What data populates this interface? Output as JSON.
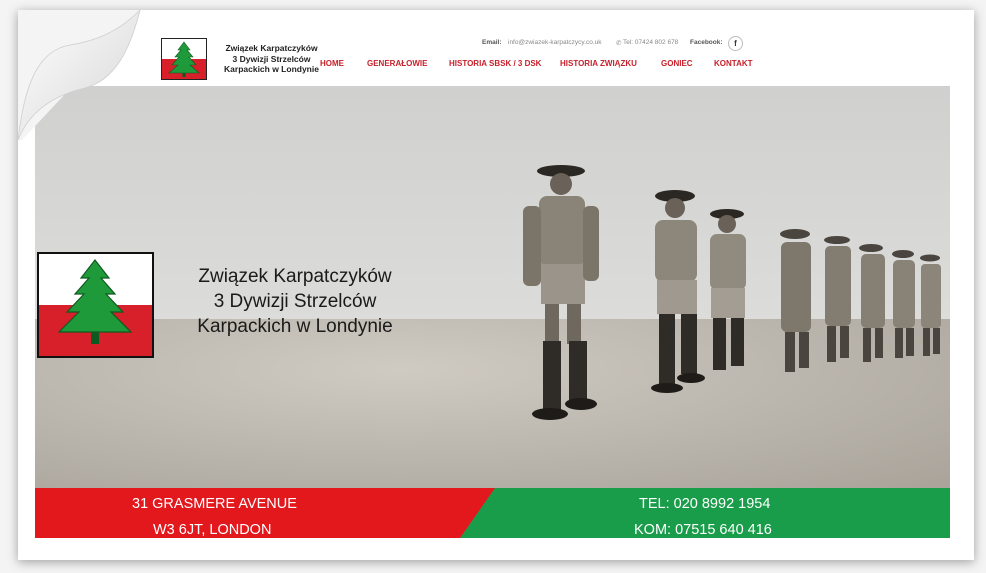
{
  "header": {
    "org_name_lines": [
      "Związek Karpatczyków",
      "3 Dywizji Strzelców",
      "Karpackich w Londynie"
    ],
    "email_label": "Email:",
    "email_value": "info@zwiazek-karpatczycy.co.uk",
    "tel_value": "Tel: 07424 802 678",
    "facebook_label": "Facebook:",
    "facebook_icon": "f"
  },
  "nav": {
    "items": [
      "HOME",
      "GENERAŁOWIE",
      "HISTORIA SBSK / 3 DSK",
      "HISTORIA ZWIĄZKU",
      "GONIEC",
      "KONTAKT"
    ]
  },
  "hero": {
    "org_name_lines": [
      "Związek Karpatczyków",
      "3 Dywizji Strzelców",
      "Karpackich w Londynie"
    ]
  },
  "footer_bar": {
    "address_line1": "31 GRASMERE AVENUE",
    "address_line2": "W3 6JT, LONDON",
    "tel": "TEL: 020 8992 1954",
    "kom": "KOM: 07515 640 416"
  },
  "colors": {
    "brand_red": "#e3181d",
    "brand_green": "#1a9d4a",
    "tree_green": "#1f9a3a",
    "nav_red": "#c8202a"
  },
  "icons": [
    "page-curl-icon",
    "phone-icon",
    "facebook-icon",
    "spruce-tree-logo-icon"
  ]
}
